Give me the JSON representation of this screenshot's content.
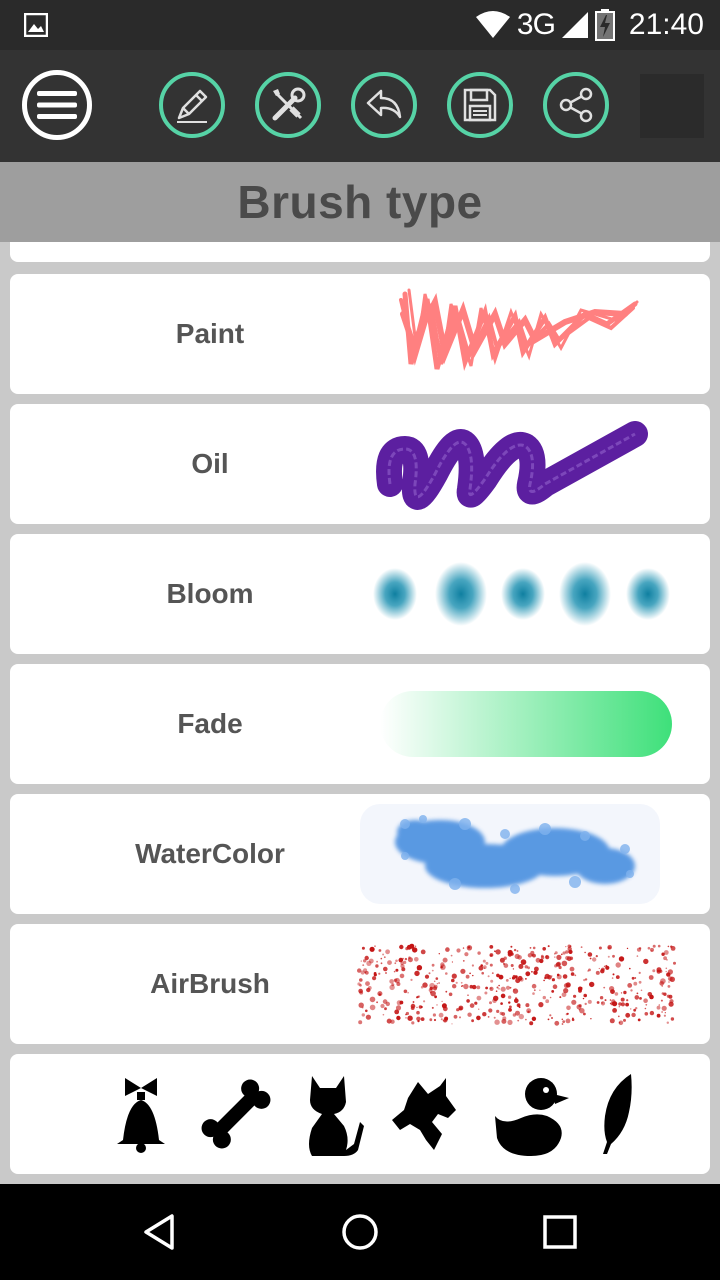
{
  "status_bar": {
    "network": "3G",
    "time": "21:40",
    "icons": [
      "image-notification-icon",
      "wifi-icon",
      "signal-icon",
      "battery-charging-icon"
    ]
  },
  "toolbar": {
    "buttons": [
      "menu-icon",
      "pencil-icon",
      "tools-icon",
      "undo-icon",
      "save-icon",
      "share-icon"
    ],
    "accent": "#56d3a6"
  },
  "header": {
    "title": "Brush type"
  },
  "brushes": [
    {
      "label": "Paint",
      "color": "#ff1a1a"
    },
    {
      "label": "Oil",
      "color": "#5c1fa0"
    },
    {
      "label": "Bloom",
      "color": "#1a8fb0"
    },
    {
      "label": "Fade",
      "color": "#3ee07a"
    },
    {
      "label": "WaterColor",
      "color": "#4a8fe0"
    },
    {
      "label": "AirBrush",
      "color": "#c41414"
    }
  ],
  "stamps": [
    "bell-icon",
    "bone-icon",
    "cat-icon",
    "dog-icon",
    "duck-icon",
    "feather-icon"
  ],
  "nav": [
    "back-icon",
    "home-icon",
    "recents-icon"
  ]
}
